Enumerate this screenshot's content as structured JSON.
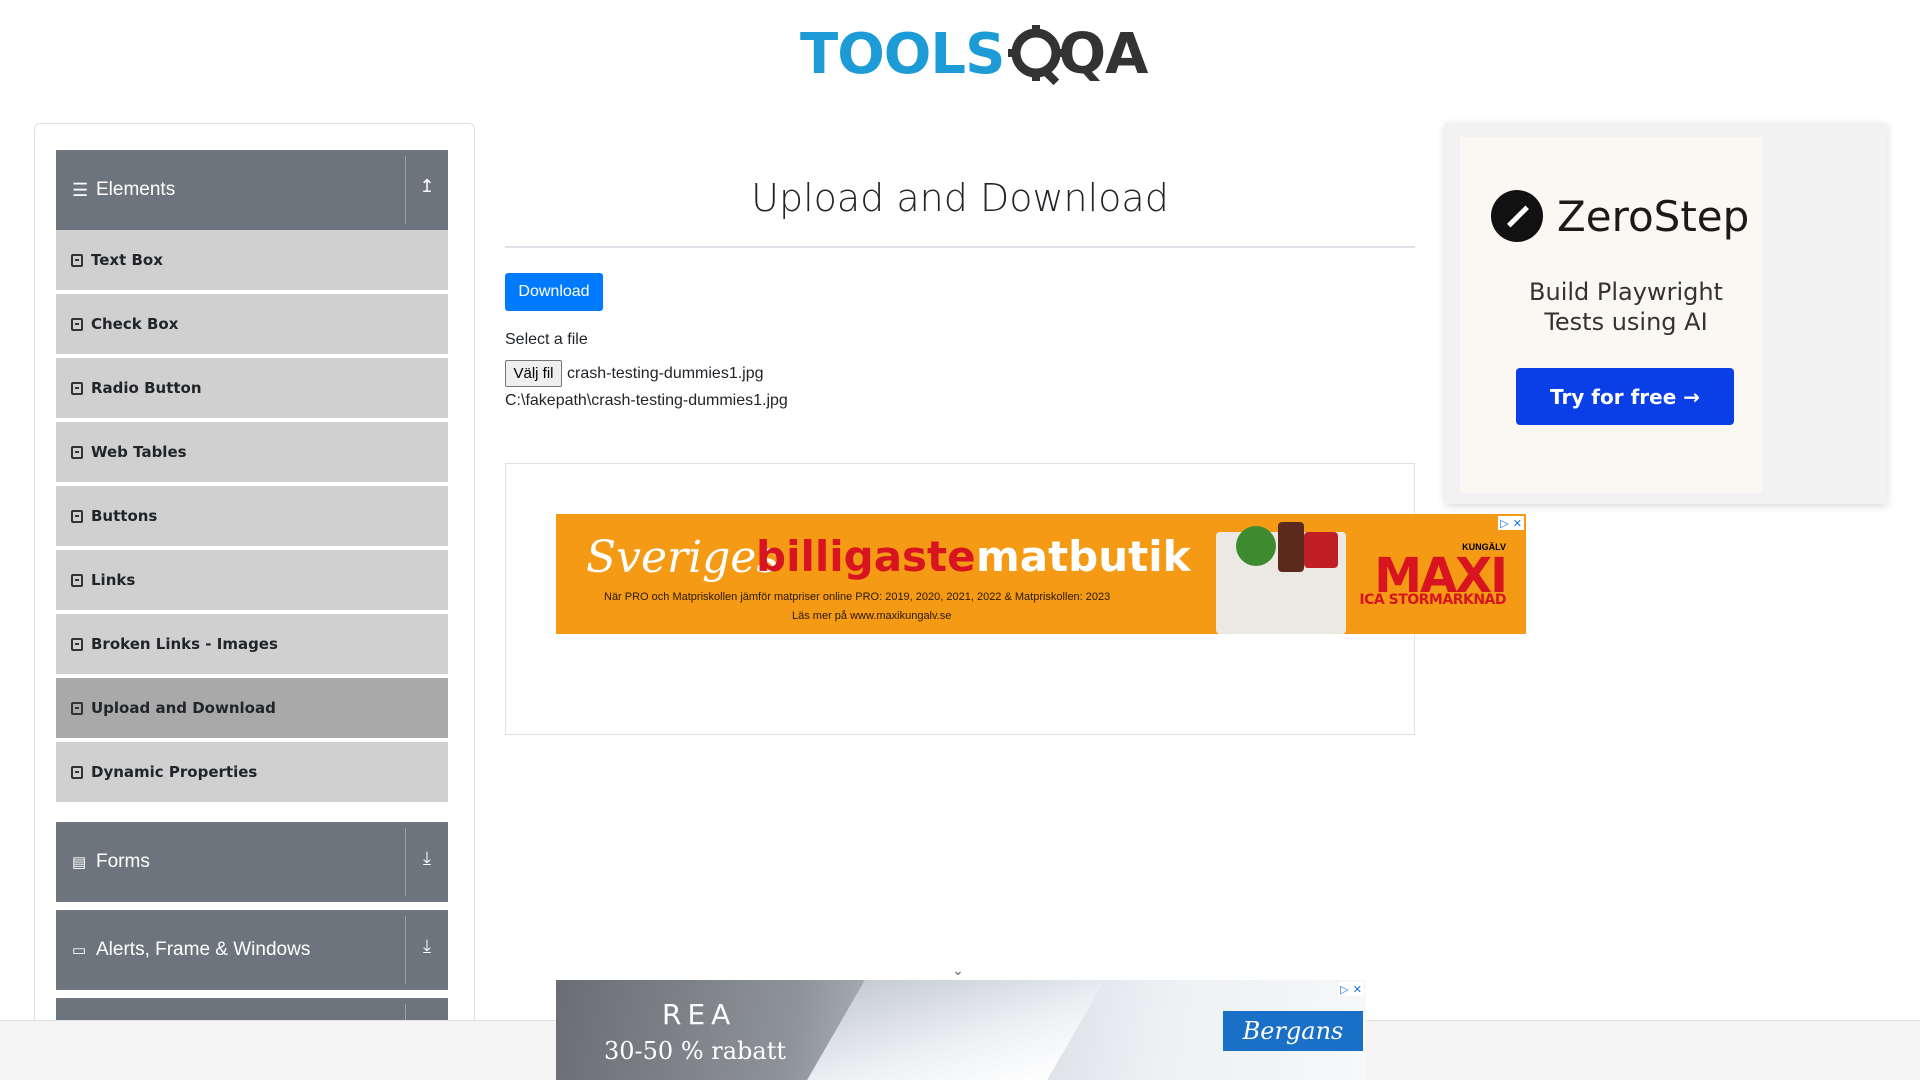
{
  "logo": {
    "part1": "TOOLS",
    "part2": "QA"
  },
  "sidebar": {
    "groups": [
      {
        "label": "Elements",
        "arrow": "↥"
      },
      {
        "label": "Forms",
        "arrow": "⤓"
      },
      {
        "label": "Alerts, Frame & Windows",
        "arrow": "⤓"
      }
    ],
    "items": [
      {
        "label": "Text Box"
      },
      {
        "label": "Check Box"
      },
      {
        "label": "Radio Button"
      },
      {
        "label": "Web Tables"
      },
      {
        "label": "Buttons"
      },
      {
        "label": "Links"
      },
      {
        "label": "Broken Links - Images"
      },
      {
        "label": "Upload and Download"
      },
      {
        "label": "Dynamic Properties"
      }
    ]
  },
  "main": {
    "title": "Upload and Download",
    "download_label": "Download",
    "select_label": "Select a file",
    "file_button": "Välj fil",
    "file_name": "crash-testing-dummies1.jpg",
    "file_path": "C:\\fakepath\\crash-testing-dummies1.jpg"
  },
  "ad_maxi": {
    "word1": "Sveriges",
    "word2": "billigaste",
    "word3": "matbutik",
    "line1": "När PRO och Matpriskollen jämför matpriser online PRO: 2019, 2020, 2021, 2022 & Matpriskollen: 2023",
    "line2": "Läs mer på www.maxikungalv.se",
    "kungalv": "KUNGÄLV",
    "brand": "MAXI",
    "sub": "ICA STORMARKNAD"
  },
  "ad_zerostep": {
    "name": "ZeroStep",
    "tagline1": "Build Playwright",
    "tagline2": "Tests using AI",
    "cta": "Try for free →"
  },
  "ad_bottom": {
    "title": "REA",
    "subtitle": "30-50 % rabatt",
    "brand": "Bergans"
  },
  "colors": {
    "accent": "#007bff",
    "sidebar_header": "#6c757d",
    "item_bg": "#d0d0d0",
    "item_active": "#a9a9a9"
  }
}
